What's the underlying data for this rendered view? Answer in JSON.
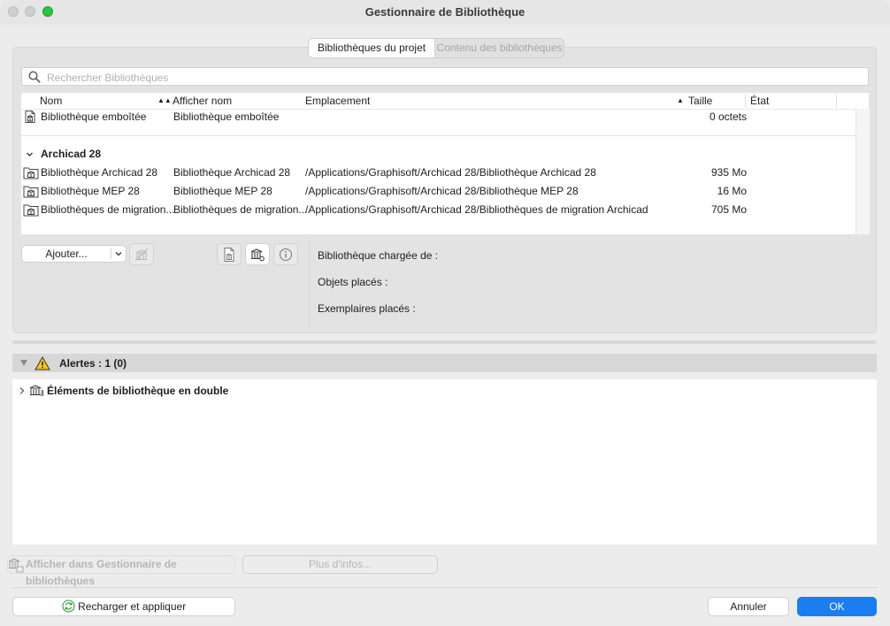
{
  "window": {
    "title": "Gestionnaire de Bibliothèque"
  },
  "tabs": [
    {
      "label": "Bibliothèques du projet",
      "active": true
    },
    {
      "label": "Contenu des bibliothèques",
      "active": false
    }
  ],
  "search": {
    "placeholder": "Rechercher Bibliothèques",
    "value": ""
  },
  "table": {
    "columns": {
      "name": "Nom",
      "display_name": "Afficher nom",
      "location": "Emplacement",
      "size": "Taille",
      "state": "État"
    },
    "rows": [
      {
        "icon": "embedded-library-icon",
        "name": "Bibliothèque emboîtée",
        "display_name": "Bibliothèque emboîtée",
        "location": "",
        "size": "0 octets",
        "state": ""
      }
    ],
    "group": {
      "label": "Archicad 28",
      "expanded": true
    },
    "group_rows": [
      {
        "icon": "library-folder-icon",
        "name": "Bibliothèque Archicad 28",
        "display_name": "Bibliothèque Archicad 28",
        "location": "/Applications/Graphisoft/Archicad 28/Bibliothèque Archicad 28",
        "size": "935 Mo",
        "state": ""
      },
      {
        "icon": "library-folder-icon",
        "name": "Bibliothèque MEP 28",
        "display_name": "Bibliothèque MEP 28",
        "location": "/Applications/Graphisoft/Archicad 28/Bibliothèque MEP 28",
        "size": "16 Mo",
        "state": ""
      },
      {
        "icon": "library-folder-icon",
        "name": "Bibliothèques de migration...",
        "display_name": "Bibliothèques de migration...",
        "location": "/Applications/Graphisoft/Archicad 28/Bibliothèques de migration Archicad",
        "size": "705 Mo",
        "state": ""
      }
    ]
  },
  "toolbar": {
    "add_label": "Ajouter..."
  },
  "info": {
    "loaded_from": "Bibliothèque chargée de :",
    "placed_objects": "Objets placés :",
    "placed_instances": "Exemplaires placés :"
  },
  "alerts": {
    "header": "Alertes : 1 (0)",
    "items": [
      {
        "label": "Éléments de bibliothèque en double"
      }
    ]
  },
  "actions": {
    "show_in_manager": "Afficher dans Gestionnaire de bibliothèques",
    "more_info": "Plus d'infos...",
    "reload_apply": "Recharger et appliquer",
    "cancel": "Annuler",
    "ok": "OK"
  },
  "colors": {
    "accent": "#1a7df0",
    "warning": "#f5c518"
  }
}
